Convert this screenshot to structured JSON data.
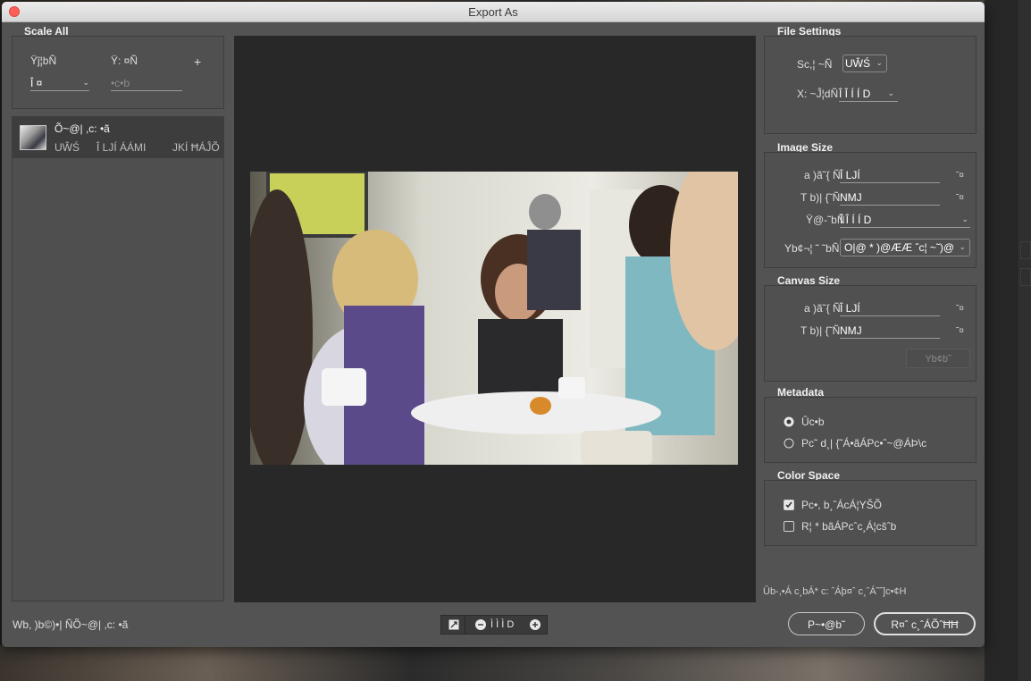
{
  "window": {
    "title": "Export As"
  },
  "scale_all": {
    "title": "Scale All",
    "col_size": "Ÿĵ¦bÑ",
    "col_suffix": "Ÿ:   ¤Ñ",
    "add_symbol": "+",
    "size_value": "Î ¤",
    "suffix_placeholder": "•c•b"
  },
  "asset": {
    "name": "Õ~@|  ,c: •ã",
    "format": "UŴŚ",
    "dimensions": "Î LJÍ ÁÁMI",
    "filesize": "JKÍ ĦÁĴÕ"
  },
  "file_settings": {
    "title": "File Settings",
    "format_label": "Sc,¦  ~Ñ",
    "format_value": "UŴŚ",
    "quality_label": "X: ~Ĵ¦dÑ",
    "quality_value": "Î Î Í Í D"
  },
  "image_size": {
    "title": "Image Size",
    "width_label": "a  )ã˜{ Ñ",
    "width_value": "Î LJÍ",
    "width_unit": "˜¤",
    "height_label": "T b)|  {˜Ñ",
    "height_value": "NMJ",
    "height_unit": "˜¤",
    "scale_label": "Ÿ@-˜bÑ",
    "scale_value": "Î Î Í Í D",
    "resample_label": "Yb¢¬¦  ˜ ˜bÑ",
    "resample_value": "O|@ * )@ÆÆ ˆc¦  ~˜)@"
  },
  "canvas_size": {
    "title": "Canvas Size",
    "width_label": "a  )ã˜{ Ñ",
    "width_value": "Î LJÍ",
    "width_unit": "˜¤",
    "height_label": "T b)|  {˜Ñ",
    "height_value": "NMJ",
    "height_unit": "˜¤",
    "reset_label": "Yb¢b˜"
  },
  "metadata": {
    "title": "Metadata",
    "option_none": "Ûc•b",
    "option_copyright": "Pc˜ d¸|  {˜Á•ãÁPc•ˆ~@ÁÞ\\c"
  },
  "color_space": {
    "title": "Color Space",
    "convert_label": "Pc•, b¸ˆÁcÁ¦YŠÕ",
    "embed_label": "R¦ * bãÁPcˆc¸Á¦cšˆb"
  },
  "footer": {
    "note": "Ûb-,•Á c¸bÁ* c: ˆÁþ¤ˆ c¸ˆÁ˜ˆ]c•¢H",
    "cancel_label": "P~•@b˜",
    "export_label": "R¤ˆ c¸ˆÁÕˆĦĦ",
    "status": "Wb, )b©)•|  ÑÕ~@|  ,c: •ã",
    "zoom_value": "Ì Ì Ì D"
  },
  "colors": {
    "close": "#fd5f57",
    "dialog_bg": "#535353",
    "preview_bg": "#282828"
  },
  "icons": [
    "close-icon",
    "plus-icon",
    "chevron-down-icon",
    "fit-to-screen-icon",
    "zoom-out-icon",
    "zoom-in-icon"
  ]
}
